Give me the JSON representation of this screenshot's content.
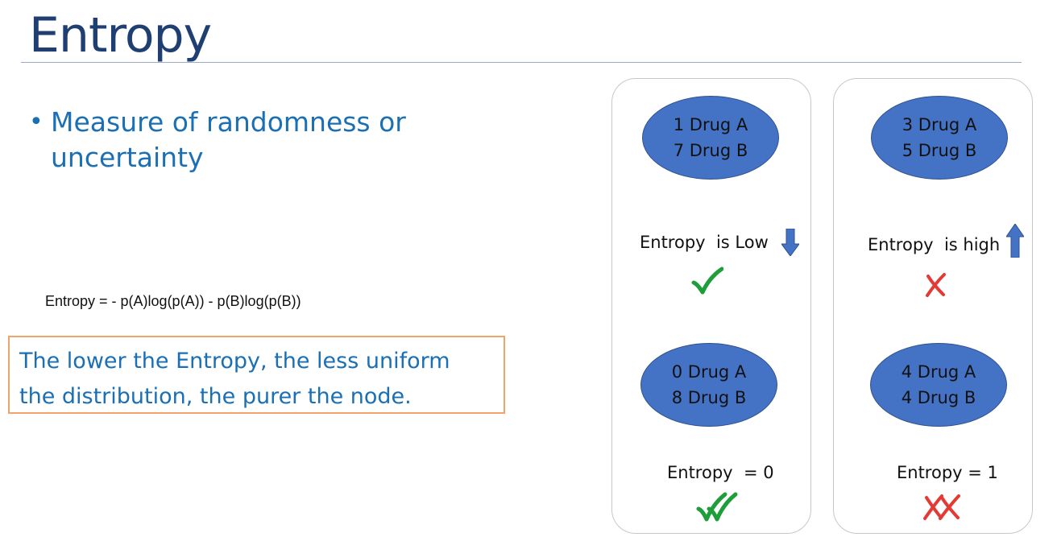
{
  "slide": {
    "title": "Entropy",
    "bullet": {
      "glyph": "•",
      "line1": "Measure of randomness or",
      "line2": "uncertainty"
    },
    "formula": "Entropy = - p(A)log(p(A)) - p(B)log(p(B))",
    "callout": {
      "line1": "The lower the Entropy, the less uniform",
      "line2": "the distribution, the purer the node."
    }
  },
  "cards": {
    "left": {
      "top_node": {
        "line1": "1 Drug A",
        "line2": "7 Drug B"
      },
      "top_label": "Entropy  is Low",
      "top_icon": "arrow-down-icon",
      "top_mark": "check-icon",
      "bottom_node": {
        "line1": "0 Drug A",
        "line2": "8 Drug B"
      },
      "bottom_label": "Entropy  = 0",
      "bottom_mark": "double-check-icon"
    },
    "right": {
      "top_node": {
        "line1": "3 Drug A",
        "line2": "5 Drug B"
      },
      "top_label": "Entropy  is high",
      "top_icon": "arrow-up-icon",
      "top_mark": "cross-icon",
      "bottom_node": {
        "line1": "4 Drug A",
        "line2": "4 Drug B"
      },
      "bottom_label": "Entropy = 1",
      "bottom_mark": "double-cross-icon"
    }
  },
  "colors": {
    "title": "#1f3f73",
    "text_accent": "#1a6fb5",
    "node_fill": "#4472c4",
    "check": "#1e9e3a",
    "cross": "#e53935",
    "callout_border": "#f0a36a"
  }
}
